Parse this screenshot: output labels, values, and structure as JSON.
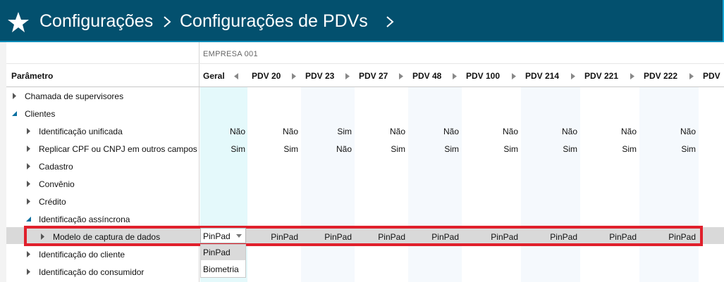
{
  "header": {
    "breadcrumb": [
      "Configurações",
      "Configurações de PDVs"
    ],
    "star_icon": "star-icon",
    "chevron_icon": "chevron-right-icon",
    "background": "#03506e"
  },
  "grid": {
    "company_label": "EMPRESA 001",
    "param_header": "Parâmetro",
    "columns": [
      "Geral",
      "PDV 20",
      "PDV 23",
      "PDV 27",
      "PDV 48",
      "PDV 100",
      "PDV 214",
      "PDV 221",
      "PDV 222",
      "PDV"
    ],
    "rows": [
      {
        "label": "Chamada de supervisores",
        "expanded": false,
        "level": 0,
        "values": []
      },
      {
        "label": "Clientes",
        "expanded": true,
        "level": 0,
        "values": []
      },
      {
        "label": "Identificação unificada",
        "expanded": false,
        "level": 1,
        "values": [
          "Não",
          "Não",
          "Sim",
          "Não",
          "Não",
          "Não",
          "Não",
          "Não",
          "Não"
        ]
      },
      {
        "label": "Replicar CPF ou CNPJ em outros campos",
        "expanded": false,
        "level": 1,
        "values": [
          "Sim",
          "Sim",
          "Não",
          "Sim",
          "Sim",
          "Sim",
          "Sim",
          "Sim",
          "Sim"
        ]
      },
      {
        "label": "Cadastro",
        "expanded": false,
        "level": 1,
        "values": []
      },
      {
        "label": "Convênio",
        "expanded": false,
        "level": 1,
        "values": []
      },
      {
        "label": "Crédito",
        "expanded": false,
        "level": 1,
        "values": []
      },
      {
        "label": "Identificação assíncrona",
        "expanded": true,
        "level": 1,
        "values": []
      },
      {
        "label": "Modelo de captura de dados",
        "expanded": false,
        "level": 2,
        "selected": true,
        "values": [
          "PinPad",
          "PinPad",
          "PinPad",
          "PinPad",
          "PinPad",
          "PinPad",
          "PinPad",
          "PinPad",
          "PinPad"
        ]
      },
      {
        "label": "Identificação do cliente",
        "expanded": false,
        "level": 1,
        "values": []
      },
      {
        "label": "Identificação do consumidor",
        "expanded": false,
        "level": 1,
        "values": []
      }
    ]
  },
  "dropdown": {
    "current": "PinPad",
    "options": [
      "PinPad",
      "Biometria"
    ],
    "selected_index": 0
  },
  "colors": {
    "highlight": "#e0202c",
    "geral_band": "#e4f9fb",
    "alt_band": "#f5f9fd",
    "selected_row": "#d9d9d9"
  }
}
